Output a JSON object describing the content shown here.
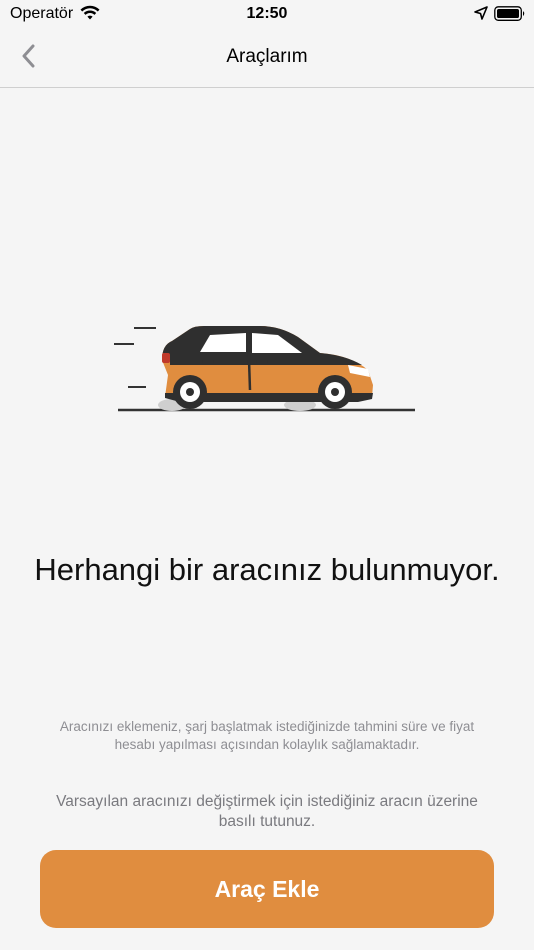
{
  "status_bar": {
    "carrier": "Operatör",
    "time": "12:50",
    "icons": [
      "wifi-icon",
      "location-icon",
      "battery-icon"
    ]
  },
  "nav": {
    "title": "Araçlarım",
    "back_icon": "chevron-left-icon"
  },
  "empty_state": {
    "illustration": "car-icon",
    "title": "Herhangi bir aracınız bulunmuyor.",
    "info": "Aracınızı eklemeniz, şarj başlatmak istediğinizde tahmini süre ve fiyat hesabı yapılması açısından kolaylık sağlamaktadır.",
    "hint": "Varsayılan aracınızı değiştirmek için istediğiniz aracın üzerine basılı tutunuz."
  },
  "actions": {
    "add_vehicle_label": "Araç Ekle"
  },
  "colors": {
    "accent": "#e08d3f",
    "background": "#f5f5f5",
    "car_body": "#e08d3f",
    "car_dark": "#2f2f2f"
  }
}
